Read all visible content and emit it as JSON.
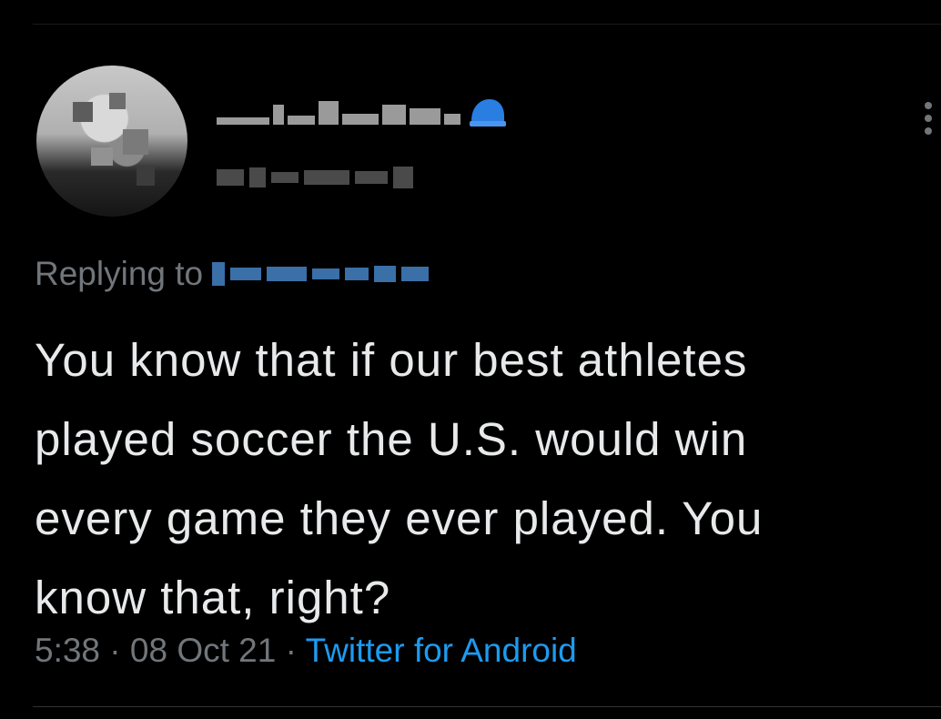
{
  "tweet": {
    "replying_prefix": "Replying to",
    "text": "You know that if our best athletes\nplayed soccer the U.S. would win\nevery game they ever played. You\nknow that, right?",
    "time": "5:38",
    "separator": "·",
    "date": "08 Oct 21",
    "source": "Twitter for Android"
  },
  "icons": {
    "verified": "verified-badge-icon",
    "more": "more-options-icon"
  },
  "colors": {
    "background": "#000000",
    "text": "#e7e9ea",
    "secondary_text": "#71767b",
    "link": "#1d9bf0"
  }
}
